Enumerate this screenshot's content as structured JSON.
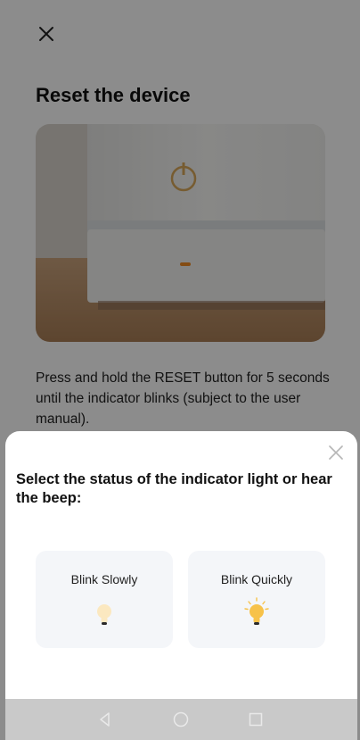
{
  "page": {
    "title": "Reset the device",
    "instruction": "Press and hold the RESET button for 5 seconds until the indicator blinks (subject to the user manual).",
    "close_icon": "close-icon"
  },
  "sheet": {
    "title": "Select the status of the indicator light or hear the beep:",
    "close_icon": "close-icon",
    "options": [
      {
        "label": "Blink Slowly",
        "icon": "bulb-icon"
      },
      {
        "label": "Blink Quickly",
        "icon": "bulb-glowing-icon"
      }
    ]
  },
  "navbar": {
    "back_icon": "back-triangle-icon",
    "home_icon": "home-circle-icon",
    "recents_icon": "recents-square-icon"
  },
  "colors": {
    "overlay": "#000000",
    "sheet_bg": "#ffffff",
    "option_bg": "#f4f6f9",
    "bulb_yellow": "#f7c24a",
    "indicator_orange": "#f08a24"
  }
}
